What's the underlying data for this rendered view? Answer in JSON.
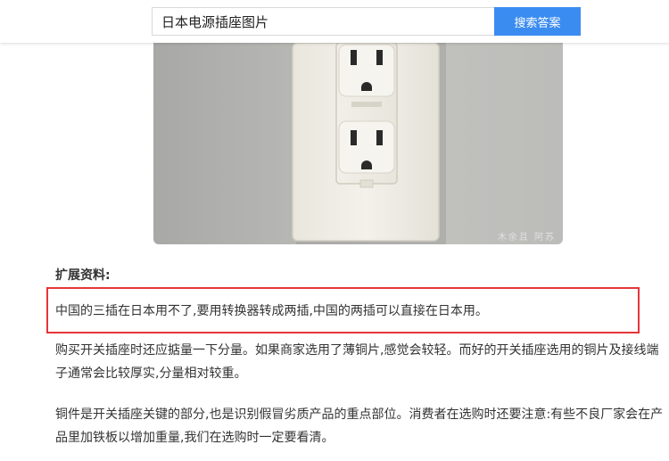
{
  "search": {
    "query": "日本电源插座图片",
    "button_label": "搜索答案"
  },
  "image": {
    "subject": "white duplex wall outlet",
    "watermark": "木余且 阿苏"
  },
  "answer": {
    "section_title": "扩展资料:",
    "highlighted_text": "中国的三插在日本用不了,要用转换器转成两插,中国的两插可以直接在日本用。",
    "paragraph_1": "购买开关插座时还应掂量一下分量。如果商家选用了薄铜片,感觉会较轻。而好的开关插座选用的铜片及接线端子通常会比较厚实,分量相对较重。",
    "paragraph_2": "铜件是开关插座关键的部分,也是识别假冒劣质产品的重点部位。消费者在选购时还要注意:有些不良厂家会在产品里加铁板以增加重量,我们在选购时一定要看清。"
  },
  "colors": {
    "accent": "#3b8cf0",
    "highlight_border": "#e5353a"
  }
}
